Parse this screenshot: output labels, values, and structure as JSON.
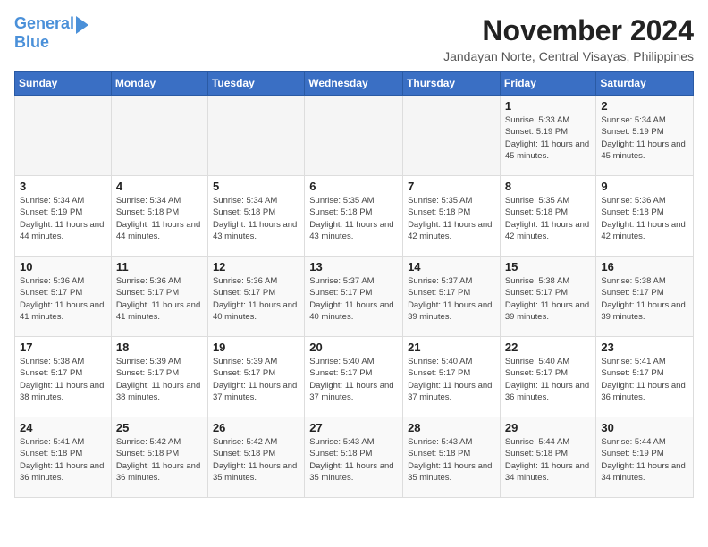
{
  "logo": {
    "line1": "General",
    "line2": "Blue"
  },
  "title": "November 2024",
  "subtitle": "Jandayan Norte, Central Visayas, Philippines",
  "days_of_week": [
    "Sunday",
    "Monday",
    "Tuesday",
    "Wednesday",
    "Thursday",
    "Friday",
    "Saturday"
  ],
  "weeks": [
    [
      {
        "day": "",
        "info": ""
      },
      {
        "day": "",
        "info": ""
      },
      {
        "day": "",
        "info": ""
      },
      {
        "day": "",
        "info": ""
      },
      {
        "day": "",
        "info": ""
      },
      {
        "day": "1",
        "info": "Sunrise: 5:33 AM\nSunset: 5:19 PM\nDaylight: 11 hours and 45 minutes."
      },
      {
        "day": "2",
        "info": "Sunrise: 5:34 AM\nSunset: 5:19 PM\nDaylight: 11 hours and 45 minutes."
      }
    ],
    [
      {
        "day": "3",
        "info": "Sunrise: 5:34 AM\nSunset: 5:19 PM\nDaylight: 11 hours and 44 minutes."
      },
      {
        "day": "4",
        "info": "Sunrise: 5:34 AM\nSunset: 5:18 PM\nDaylight: 11 hours and 44 minutes."
      },
      {
        "day": "5",
        "info": "Sunrise: 5:34 AM\nSunset: 5:18 PM\nDaylight: 11 hours and 43 minutes."
      },
      {
        "day": "6",
        "info": "Sunrise: 5:35 AM\nSunset: 5:18 PM\nDaylight: 11 hours and 43 minutes."
      },
      {
        "day": "7",
        "info": "Sunrise: 5:35 AM\nSunset: 5:18 PM\nDaylight: 11 hours and 42 minutes."
      },
      {
        "day": "8",
        "info": "Sunrise: 5:35 AM\nSunset: 5:18 PM\nDaylight: 11 hours and 42 minutes."
      },
      {
        "day": "9",
        "info": "Sunrise: 5:36 AM\nSunset: 5:18 PM\nDaylight: 11 hours and 42 minutes."
      }
    ],
    [
      {
        "day": "10",
        "info": "Sunrise: 5:36 AM\nSunset: 5:17 PM\nDaylight: 11 hours and 41 minutes."
      },
      {
        "day": "11",
        "info": "Sunrise: 5:36 AM\nSunset: 5:17 PM\nDaylight: 11 hours and 41 minutes."
      },
      {
        "day": "12",
        "info": "Sunrise: 5:36 AM\nSunset: 5:17 PM\nDaylight: 11 hours and 40 minutes."
      },
      {
        "day": "13",
        "info": "Sunrise: 5:37 AM\nSunset: 5:17 PM\nDaylight: 11 hours and 40 minutes."
      },
      {
        "day": "14",
        "info": "Sunrise: 5:37 AM\nSunset: 5:17 PM\nDaylight: 11 hours and 39 minutes."
      },
      {
        "day": "15",
        "info": "Sunrise: 5:38 AM\nSunset: 5:17 PM\nDaylight: 11 hours and 39 minutes."
      },
      {
        "day": "16",
        "info": "Sunrise: 5:38 AM\nSunset: 5:17 PM\nDaylight: 11 hours and 39 minutes."
      }
    ],
    [
      {
        "day": "17",
        "info": "Sunrise: 5:38 AM\nSunset: 5:17 PM\nDaylight: 11 hours and 38 minutes."
      },
      {
        "day": "18",
        "info": "Sunrise: 5:39 AM\nSunset: 5:17 PM\nDaylight: 11 hours and 38 minutes."
      },
      {
        "day": "19",
        "info": "Sunrise: 5:39 AM\nSunset: 5:17 PM\nDaylight: 11 hours and 37 minutes."
      },
      {
        "day": "20",
        "info": "Sunrise: 5:40 AM\nSunset: 5:17 PM\nDaylight: 11 hours and 37 minutes."
      },
      {
        "day": "21",
        "info": "Sunrise: 5:40 AM\nSunset: 5:17 PM\nDaylight: 11 hours and 37 minutes."
      },
      {
        "day": "22",
        "info": "Sunrise: 5:40 AM\nSunset: 5:17 PM\nDaylight: 11 hours and 36 minutes."
      },
      {
        "day": "23",
        "info": "Sunrise: 5:41 AM\nSunset: 5:17 PM\nDaylight: 11 hours and 36 minutes."
      }
    ],
    [
      {
        "day": "24",
        "info": "Sunrise: 5:41 AM\nSunset: 5:18 PM\nDaylight: 11 hours and 36 minutes."
      },
      {
        "day": "25",
        "info": "Sunrise: 5:42 AM\nSunset: 5:18 PM\nDaylight: 11 hours and 36 minutes."
      },
      {
        "day": "26",
        "info": "Sunrise: 5:42 AM\nSunset: 5:18 PM\nDaylight: 11 hours and 35 minutes."
      },
      {
        "day": "27",
        "info": "Sunrise: 5:43 AM\nSunset: 5:18 PM\nDaylight: 11 hours and 35 minutes."
      },
      {
        "day": "28",
        "info": "Sunrise: 5:43 AM\nSunset: 5:18 PM\nDaylight: 11 hours and 35 minutes."
      },
      {
        "day": "29",
        "info": "Sunrise: 5:44 AM\nSunset: 5:18 PM\nDaylight: 11 hours and 34 minutes."
      },
      {
        "day": "30",
        "info": "Sunrise: 5:44 AM\nSunset: 5:19 PM\nDaylight: 11 hours and 34 minutes."
      }
    ]
  ]
}
